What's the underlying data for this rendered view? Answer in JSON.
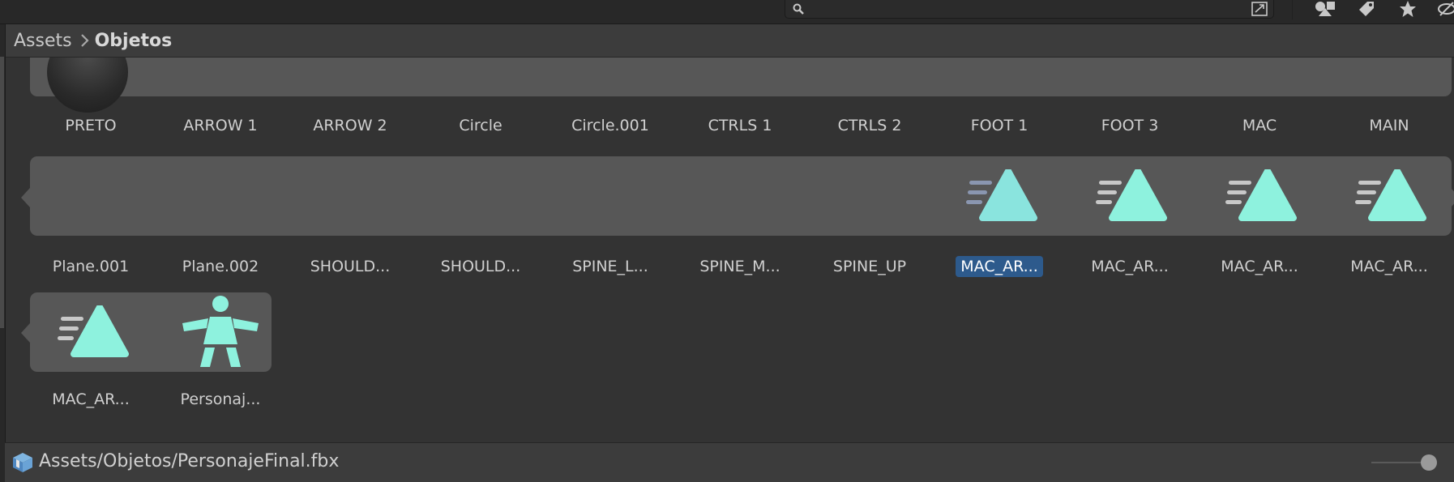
{
  "breadcrumb": {
    "root": "Assets",
    "current": "Objetos"
  },
  "search": {
    "placeholder": ""
  },
  "assets": [
    {
      "label": "PRETO",
      "icon": "sphere-preview"
    },
    {
      "label": "ARROW 1",
      "icon": "mesh"
    },
    {
      "label": "ARROW 2",
      "icon": "mesh"
    },
    {
      "label": "Circle",
      "icon": "mesh"
    },
    {
      "label": "Circle.001",
      "icon": "mesh"
    },
    {
      "label": "CTRLS 1",
      "icon": "mesh"
    },
    {
      "label": "CTRLS 2",
      "icon": "mesh"
    },
    {
      "label": "FOOT 1",
      "icon": "mesh"
    },
    {
      "label": "FOOT 3",
      "icon": "mesh"
    },
    {
      "label": "MAC",
      "icon": "mesh"
    },
    {
      "label": "MAIN",
      "icon": "mesh"
    },
    {
      "label": "Plane.001",
      "icon": "mesh"
    },
    {
      "label": "Plane.002",
      "icon": "mesh"
    },
    {
      "label": "SHOULD...",
      "icon": "mesh"
    },
    {
      "label": "SHOULD...",
      "icon": "mesh"
    },
    {
      "label": "SPINE_L...",
      "icon": "mesh"
    },
    {
      "label": "SPINE_M...",
      "icon": "mesh"
    },
    {
      "label": "SPINE_UP",
      "icon": "mesh"
    },
    {
      "label": "MAC_AR...",
      "icon": "animation-clip-icon",
      "selected": true
    },
    {
      "label": "MAC_AR...",
      "icon": "animation-clip-icon"
    },
    {
      "label": "MAC_AR...",
      "icon": "animation-clip-icon"
    },
    {
      "label": "MAC_AR...",
      "icon": "animation-clip-icon"
    },
    {
      "label": "MAC_AR...",
      "icon": "animation-clip-icon"
    },
    {
      "label": "Personaj...",
      "icon": "avatar-icon"
    }
  ],
  "status": {
    "path": "Assets/Objetos/PersonajeFinal.fbx"
  },
  "zoom_slider": {
    "value": 0.75
  },
  "colors": {
    "accent_teal": "#8ef2de",
    "selection": "#2d5a8c",
    "group_background": "#575757",
    "panel": "#333333"
  },
  "icons": {
    "search": "search-icon",
    "expand": "expand-icon",
    "filter_type": "filter-by-type-icon",
    "filter_label": "tag-icon",
    "favorite": "star-icon",
    "visibility": "eye-slash-icon",
    "breadcrumb_separator": "chevron-right-icon",
    "status": "package-icon"
  }
}
